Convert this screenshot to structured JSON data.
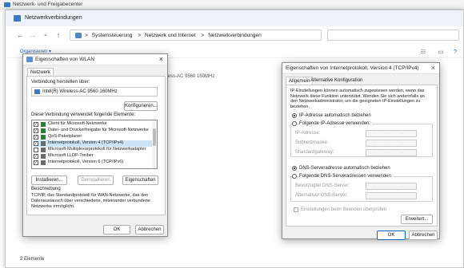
{
  "background_window": {
    "title": "Netzwerk- und Freigabecenter"
  },
  "main_window": {
    "title": "Netzwerkverbindungen",
    "breadcrumbs": [
      "Systemsteuerung",
      "Netzwerk und Internet",
      "Netzwerkverbindungen"
    ],
    "breadcrumb_separator": ">",
    "nav_icons": [
      "back-arrow-icon",
      "forward-arrow-icon",
      "chevron-down-icon",
      "up-arrow-icon"
    ],
    "toolbar": {
      "organize_label": "Organisieren ▾"
    },
    "adapter_desc_partial": "eless-AC 9560 160MHz",
    "status_count": "2 Elemente"
  },
  "wlan_dialog": {
    "title": "Eigenschaften von WLAN",
    "tab": "Netzwerk",
    "connect_label": "Verbindung herstellen über:",
    "adapter_name": "Intel(R) Wireless-AC 9560 160MHz",
    "configure_button": "Konfigurieren...",
    "components_label": "Diese Verbindung verwendet folgende Elemente:",
    "components": [
      {
        "label": "Client für Microsoft-Netzwerke",
        "checked": true
      },
      {
        "label": "Datei- und Druckerfreigabe für Microsoft-Netzwerke",
        "checked": true
      },
      {
        "label": "QoS-Paketplaner",
        "checked": true
      },
      {
        "label": "Internetprotokoll, Version 4 (TCP/IPv4)",
        "checked": true
      },
      {
        "label": "Microsoft-Multiplexorprotokoll für Netzwerkadapter",
        "checked": false
      },
      {
        "label": "Microsoft LLDP-Treiber",
        "checked": true
      },
      {
        "label": "Internetprotokoll, Version 6 (TCP/IPv6)",
        "checked": true
      }
    ],
    "install_button": "Installieren...",
    "uninstall_button": "Deinstallieren",
    "properties_button": "Eigenschaften",
    "description_title": "Beschreibung",
    "description_text": "TCP/IP, das Standardprotokoll für WAN-Netzwerke, das den Datenaustausch über verschiedene, miteinander verbundene Netzwerke ermöglicht.",
    "ok_button": "OK",
    "cancel_button": "Abbrechen"
  },
  "ipv4_dialog": {
    "title": "Eigenschaften von Internetprotokoll, Version 4 (TCP/IPv4)",
    "tabs": [
      "Allgemein",
      "Alternative Konfiguration"
    ],
    "intro_text": "IP-Einstellungen können automatisch zugewiesen werden, wenn das Netzwerk diese Funktion unterstützt. Wenden Sie sich andernfalls an den Netzwerkadministrator, um die geeigneten IP-Einstellungen zu beziehen.",
    "ip_auto_label": "IP-Adresse automatisch beziehen",
    "ip_manual_label": "Folgende IP-Adresse verwenden:",
    "ip_address_label": "IP-Adresse:",
    "subnet_label": "Subnetzmaske:",
    "gateway_label": "Standardgateway:",
    "dns_auto_label": "DNS-Serveradresse automatisch beziehen",
    "dns_manual_label": "Folgende DNS-Serveradressen verwenden:",
    "dns_preferred_label": "Bevorzugter DNS-Server:",
    "dns_alternate_label": "Alternativer DNS-Server:",
    "validate_label": "Einstellungen beim Beenden überprüfen",
    "advanced_button": "Erweitert...",
    "ok_button": "OK",
    "cancel_button": "Abbrechen",
    "ip_placeholder": ". . ."
  }
}
